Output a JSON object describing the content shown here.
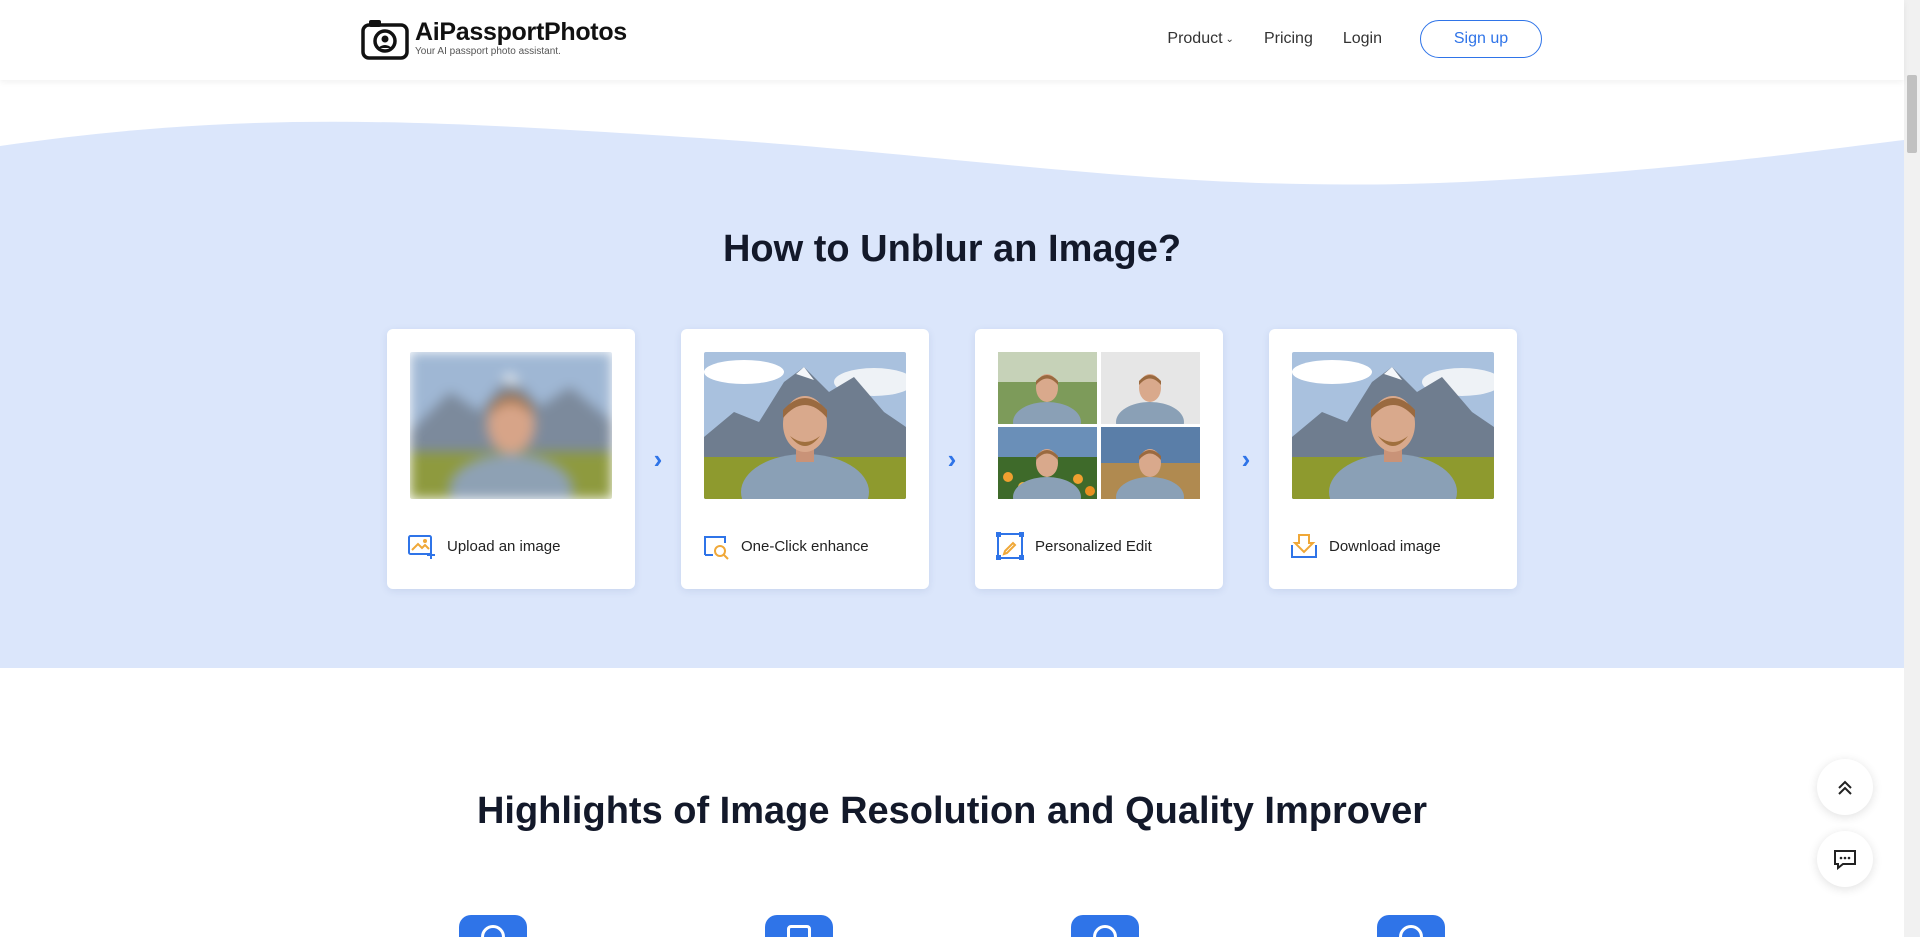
{
  "header": {
    "logo_name": "AiPassportPhotos",
    "logo_tagline": "Your AI passport photo assistant.",
    "nav": {
      "product": "Product",
      "pricing": "Pricing",
      "login": "Login",
      "signup": "Sign up"
    }
  },
  "how_section": {
    "title": "How to Unblur an Image?",
    "steps": [
      {
        "label": "Upload an image",
        "icon": "upload-image-icon"
      },
      {
        "label": "One-Click enhance",
        "icon": "enhance-icon"
      },
      {
        "label": "Personalized Edit",
        "icon": "edit-icon"
      },
      {
        "label": "Download image",
        "icon": "download-icon"
      }
    ],
    "arrow_icon": "chevron-right-icon"
  },
  "highlights": {
    "title": "Highlights of Image Resolution and Quality Improver"
  },
  "floating": {
    "scroll_top_icon": "double-chevron-up-icon",
    "chat_icon": "chat-icon"
  },
  "colors": {
    "accent": "#2f74e8",
    "section_bg": "#dbe6fb",
    "title": "#13192a"
  }
}
